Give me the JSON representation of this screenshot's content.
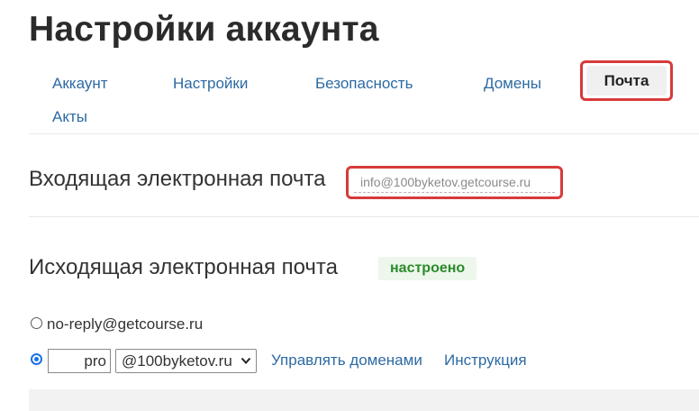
{
  "page": {
    "title": "Настройки аккаунта"
  },
  "tabs": [
    {
      "label": "Аккаунт"
    },
    {
      "label": "Настройки"
    },
    {
      "label": "Безопасность"
    },
    {
      "label": "Домены"
    },
    {
      "label": "Почта",
      "active": true
    },
    {
      "label": "Акты"
    }
  ],
  "incoming": {
    "title": "Входящая электронная почта",
    "value": "info@100byketov.getcourse.ru"
  },
  "outgoing": {
    "title": "Исходящая электронная почта",
    "status": "настроено",
    "options": [
      {
        "label": "no-reply@getcourse.ru",
        "selected": false
      },
      {
        "prefix": "pro",
        "domain": "@100byketov.ru",
        "selected": true
      }
    ],
    "manage_domains_link": "Управлять доменами",
    "instructions_link": "Инструкция"
  },
  "colors": {
    "highlight": "#d83a3a",
    "link": "#2d6aa3",
    "status_green": "#2b8a2b",
    "radio_blue": "#1a73e8"
  }
}
